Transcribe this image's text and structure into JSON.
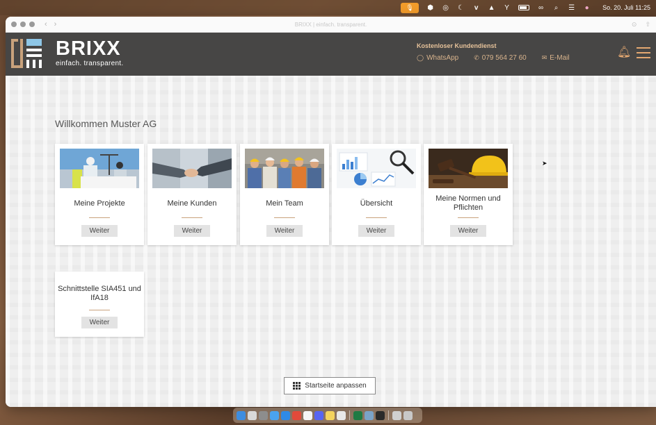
{
  "menubar": {
    "date_time": "So. 20. Juli  11:25",
    "icons": [
      "apple-icon",
      "mic-icon",
      "app-icon",
      "globe-icon",
      "moon-icon",
      "vimeo-icon",
      "drive-icon",
      "network-icon",
      "battery-icon",
      "link-icon",
      "search-icon",
      "control-center-icon",
      "siri-icon"
    ]
  },
  "browser": {
    "url_title": "BRIXX | einfach. transparent."
  },
  "header": {
    "brand_name": "BRIXX",
    "brand_tagline": "einfach. transparent.",
    "contact_title": "Kostenloser Kundendienst",
    "whatsapp_label": "WhatsApp",
    "phone_label": "079 564 27 60",
    "email_label": "E-Mail",
    "accent_color": "#e4a871"
  },
  "main": {
    "welcome": "Willkommen Muster AG",
    "cards": [
      {
        "title": "Meine Projekte",
        "button": "Weiter",
        "image": "construction-workers-plans"
      },
      {
        "title": "Meine Kunden",
        "button": "Weiter",
        "image": "handshake"
      },
      {
        "title": "Mein Team",
        "button": "Weiter",
        "image": "team-workers"
      },
      {
        "title": "Übersicht",
        "button": "Weiter",
        "image": "charts-magnifier"
      },
      {
        "title": "Meine Normen und Pflichten",
        "button": "Weiter",
        "image": "gavel-helmet"
      },
      {
        "title": "Schnittstelle SIA451 und IfA18",
        "button": "Weiter"
      }
    ],
    "customize_button": "Startseite anpassen"
  }
}
